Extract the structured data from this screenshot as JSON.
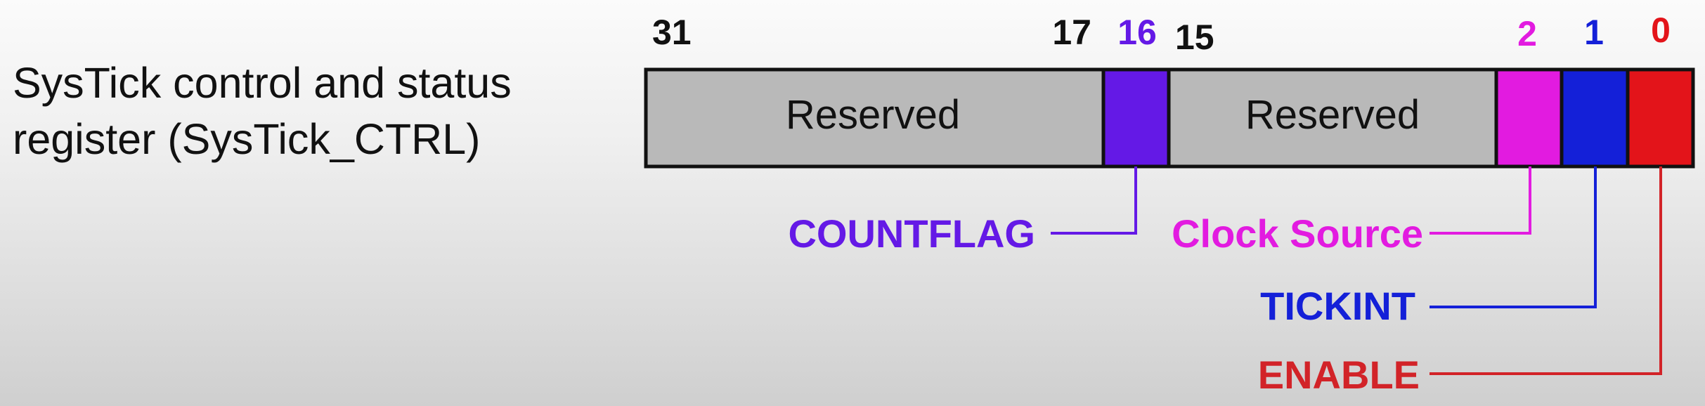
{
  "register": {
    "title_line1": "SysTick control and status",
    "title_line2": "register (SysTick_CTRL)"
  },
  "bit_labels": {
    "b31": "31",
    "b17": "17",
    "b16": "16",
    "b15": "15",
    "b2": "2",
    "b1": "1",
    "b0": "0"
  },
  "fields": {
    "reserved_high": "Reserved",
    "reserved_low": "Reserved",
    "countflag": "COUNTFLAG",
    "clock_source": "Clock Source",
    "tickint": "TICKINT",
    "enable": "ENABLE"
  },
  "colors": {
    "reserved": "#b9b9b9",
    "countflag": "#6419e6",
    "clock_source": "#e21be0",
    "tickint": "#1420d8",
    "enable": "#e3141a",
    "enable_label": "#d22328",
    "outline": "#111111"
  }
}
